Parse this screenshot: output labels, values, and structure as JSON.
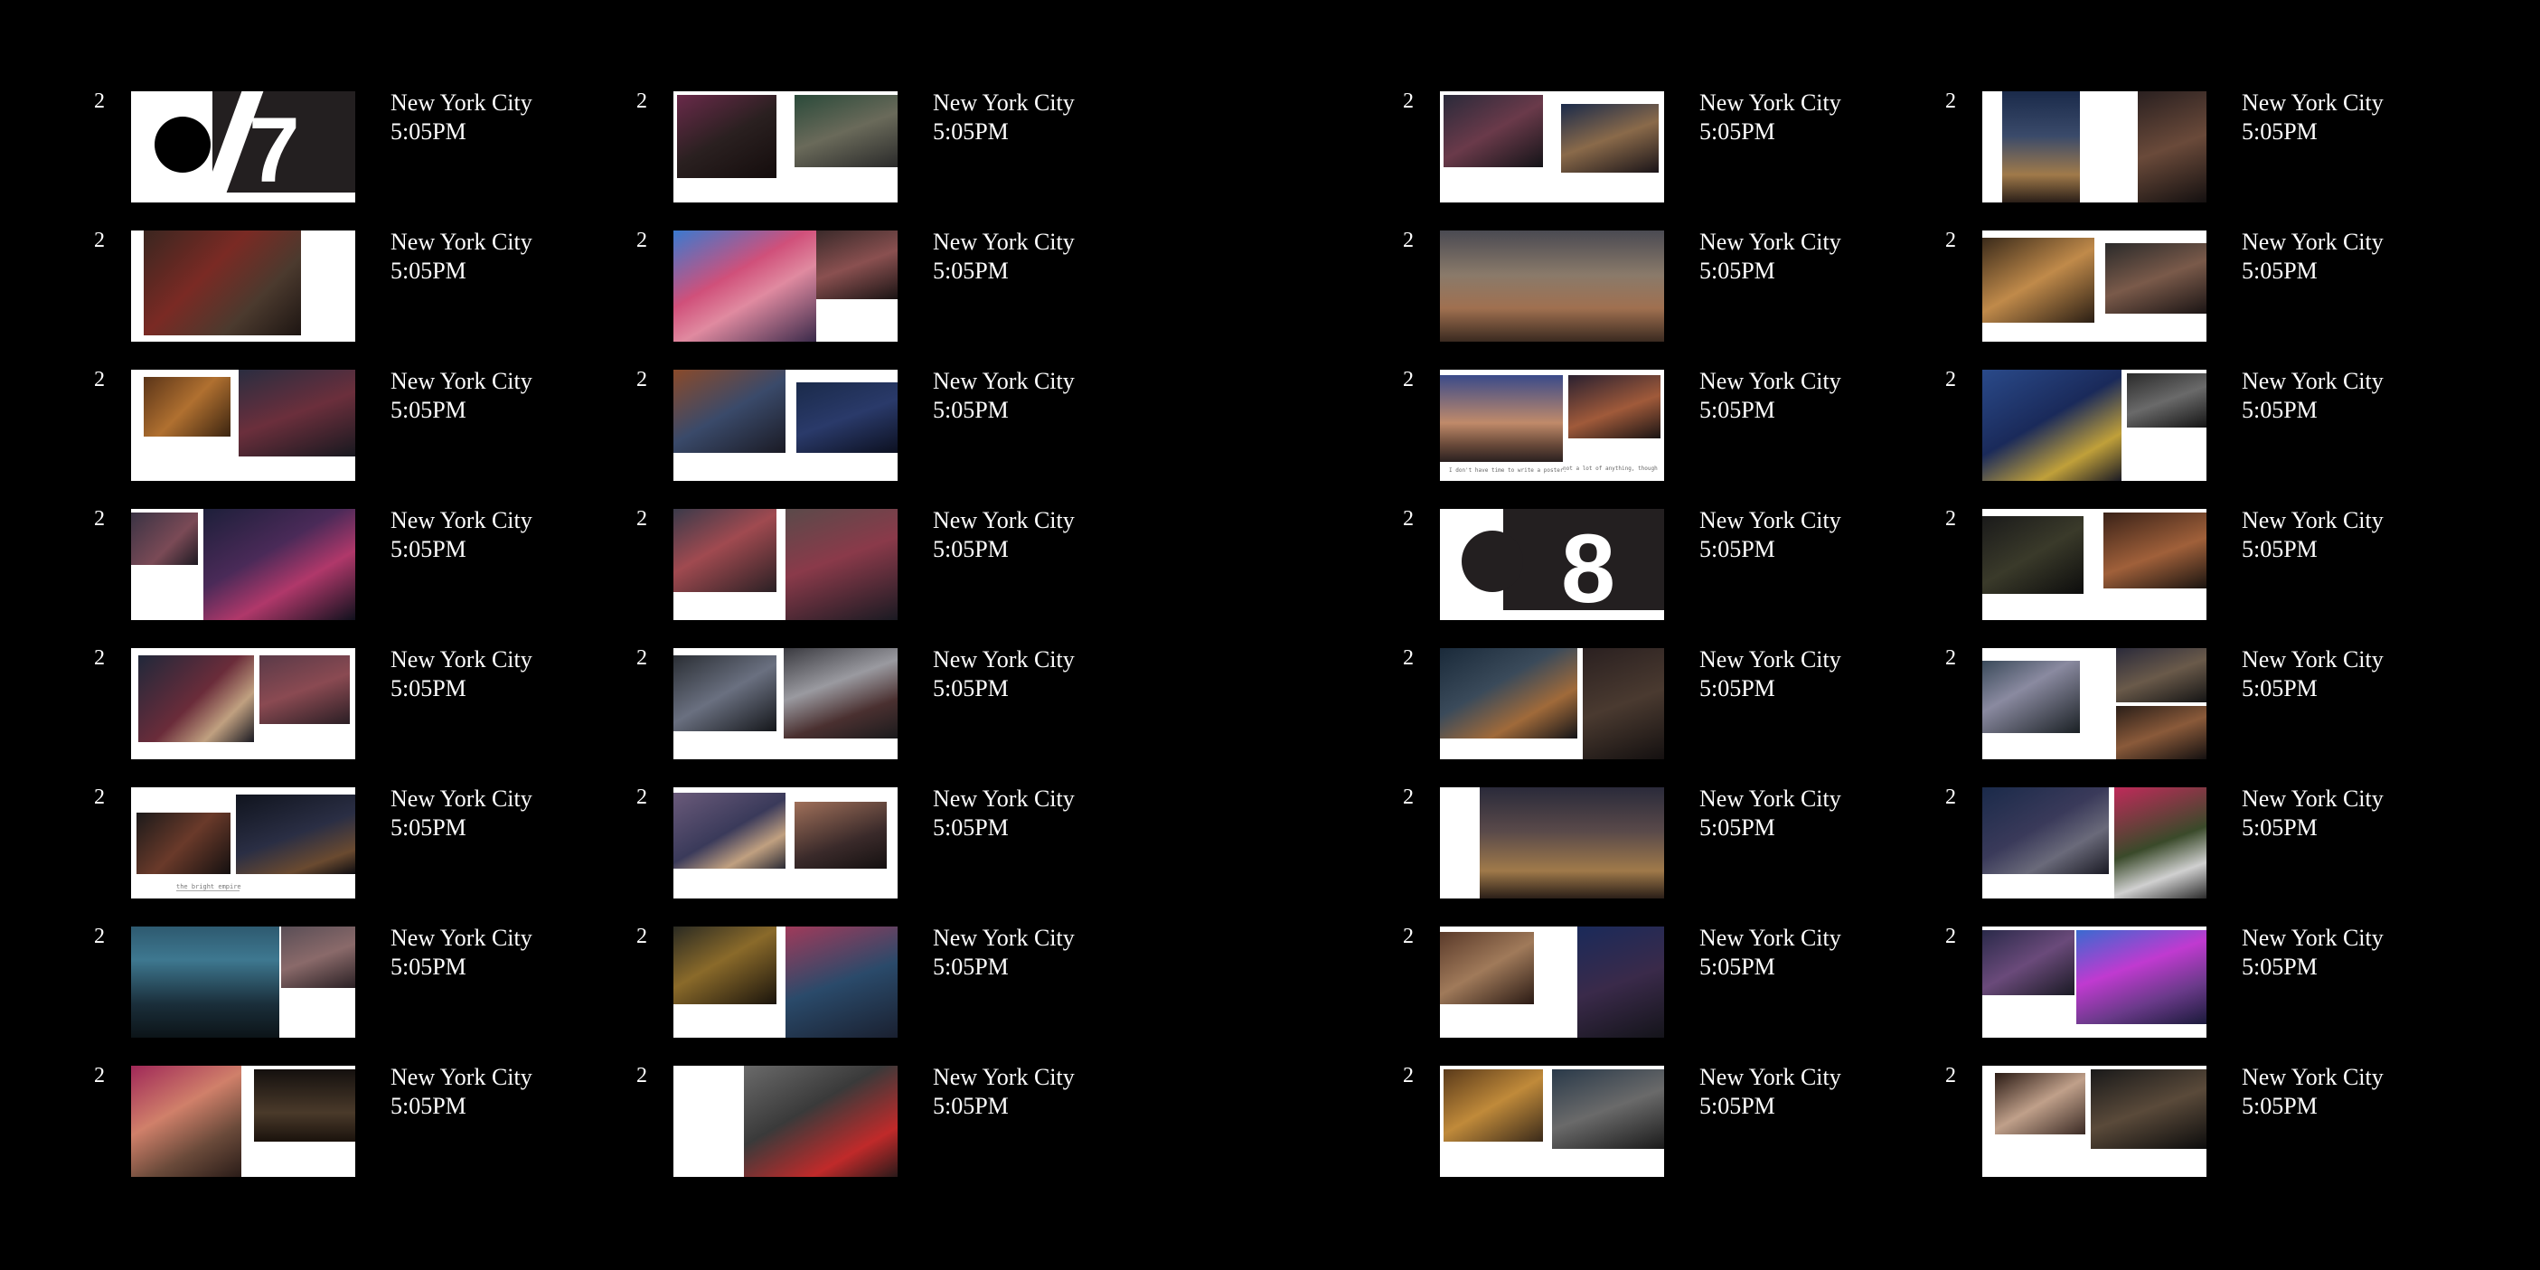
{
  "rows": [
    {
      "number": "2",
      "city": "New York City",
      "time": "5:05PM"
    },
    {
      "number": "2",
      "city": "New York City",
      "time": "5:05PM"
    },
    {
      "number": "2",
      "city": "New York City",
      "time": "5:05PM"
    },
    {
      "number": "2",
      "city": "New York City",
      "time": "5:05PM"
    },
    {
      "number": "2",
      "city": "New York City",
      "time": "5:05PM"
    },
    {
      "number": "2",
      "city": "New York City",
      "time": "5:05PM"
    },
    {
      "number": "2",
      "city": "New York City",
      "time": "5:05PM"
    },
    {
      "number": "2",
      "city": "New York City",
      "time": "5:05PM"
    }
  ],
  "chapter_markers": {
    "first": "7",
    "second": "8"
  },
  "thumb_captions": {
    "col1_row6": "the bright empire",
    "col3_row3_left": "I don't have time to write a poster.",
    "col3_row3_right": "not a lot of anything, though"
  },
  "colors": {
    "background": "#000000",
    "page": "#ffffff",
    "marker_block": "#231f20"
  }
}
